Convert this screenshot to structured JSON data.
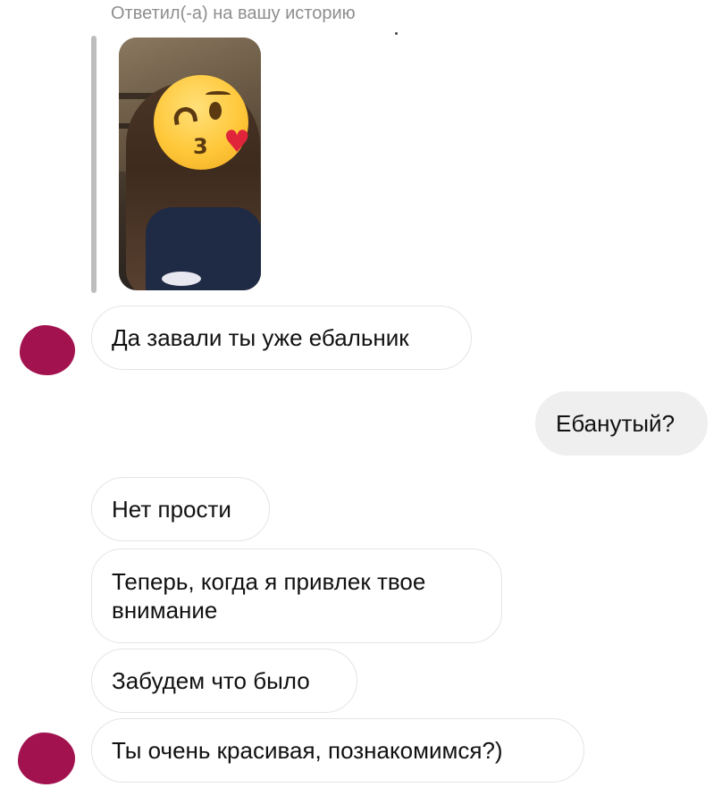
{
  "story_reply": {
    "caption": "Ответил(-а) на вашу историю"
  },
  "messages": [
    {
      "side": "incoming",
      "text": "Да завали ты уже ебальник"
    },
    {
      "side": "outgoing",
      "text": "Ебанутый?"
    },
    {
      "side": "incoming",
      "text": "Нет прости"
    },
    {
      "side": "incoming",
      "text": "Теперь, когда я привлек твое внимание"
    },
    {
      "side": "incoming",
      "text": "Забудем что было"
    },
    {
      "side": "incoming",
      "text": "Ты очень красивая, познакомимся?)"
    }
  ],
  "icons": {
    "story_emoji": "kissing-face-with-heart-icon",
    "avatar": "avatar-redacted"
  },
  "colors": {
    "avatar_fill": "#a2124f",
    "outgoing_bubble": "#efefef",
    "incoming_border": "#e4e4e4",
    "caption_text": "#8e8e8e"
  }
}
